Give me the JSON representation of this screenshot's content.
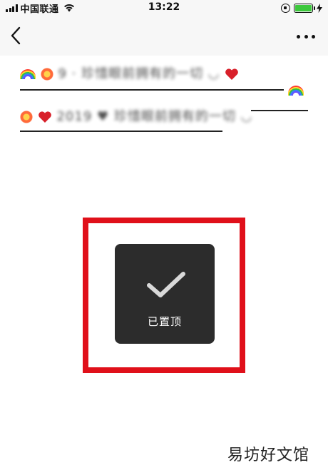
{
  "status_bar": {
    "carrier": "中国联通",
    "time": "13:22",
    "battery_level": 1.0,
    "battery_color": "#3cc83c"
  },
  "nav": {
    "back_icon": "chevron-left-icon",
    "more_icon": "more-dots-icon"
  },
  "messages": [
    {
      "visible_text": "9 · 珍惜眼前拥有的一切 ◡",
      "decor": [
        "rainbow-emoji",
        "explosion-emoji",
        "heart-emoji"
      ]
    },
    {
      "visible_text": "2019 ♥ 珍惜眼前拥有的一切 ◡",
      "decor": [
        "explosion-emoji",
        "heart-emoji",
        "rainbow-emoji"
      ]
    }
  ],
  "toast": {
    "icon": "checkmark-icon",
    "label": "已置顶",
    "background": "#2c2c2c"
  },
  "highlight_color": "#e0101a",
  "watermark": "易坊好文馆"
}
